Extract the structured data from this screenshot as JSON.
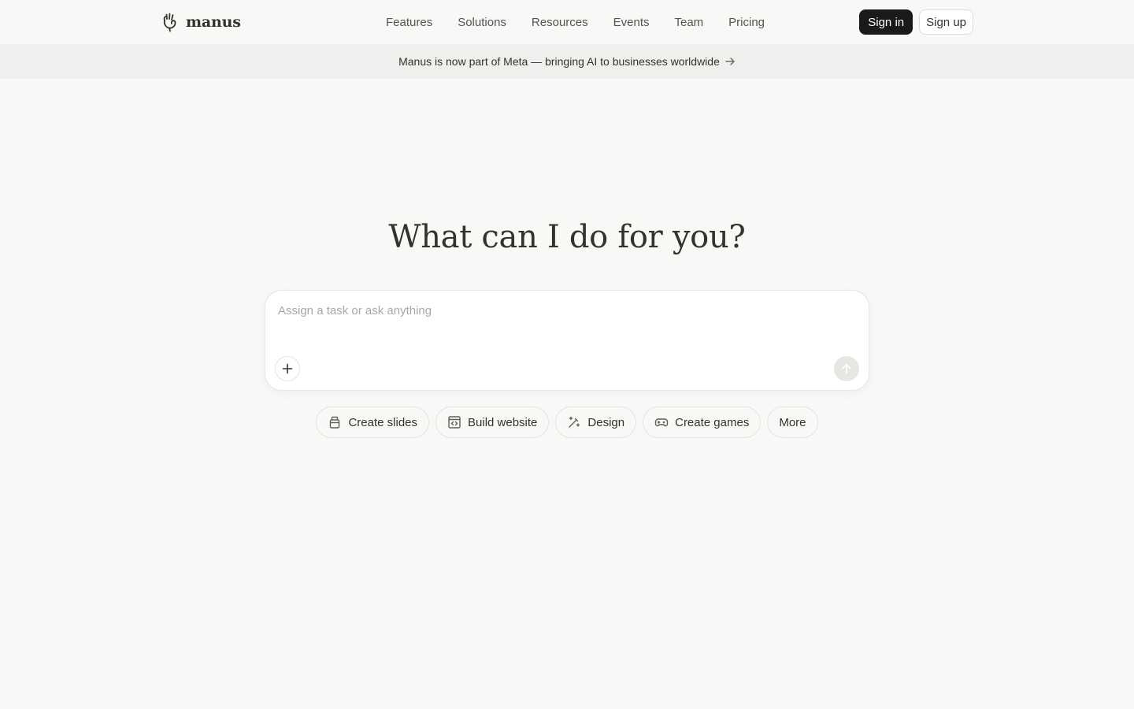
{
  "brand": {
    "name": "manus",
    "icon": "manus-hand-logo-icon"
  },
  "nav": {
    "items": [
      "Features",
      "Solutions",
      "Resources",
      "Events",
      "Team",
      "Pricing"
    ]
  },
  "auth": {
    "signin_label": "Sign in",
    "signup_label": "Sign up"
  },
  "banner": {
    "text": "Manus is now part of Meta — bringing AI to businesses worldwide",
    "icon": "arrow-right-icon"
  },
  "hero": {
    "title": "What can I do for you?"
  },
  "prompt": {
    "placeholder": "Assign a task or ask anything",
    "value": "",
    "attach_icon": "plus-icon",
    "send_icon": "arrow-up-icon"
  },
  "chips": [
    {
      "label": "Create slides",
      "icon": "slides-icon"
    },
    {
      "label": "Build website",
      "icon": "website-code-icon"
    },
    {
      "label": "Design",
      "icon": "design-wand-icon"
    },
    {
      "label": "Create games",
      "icon": "gamepad-icon"
    },
    {
      "label": "More",
      "icon": ""
    }
  ],
  "colors": {
    "background": "#f8f8f7",
    "banner_bg": "#efefed",
    "primary_button": "#1a1a19",
    "text": "#34322d",
    "muted_text": "#535350",
    "placeholder": "#a8a8a4"
  }
}
